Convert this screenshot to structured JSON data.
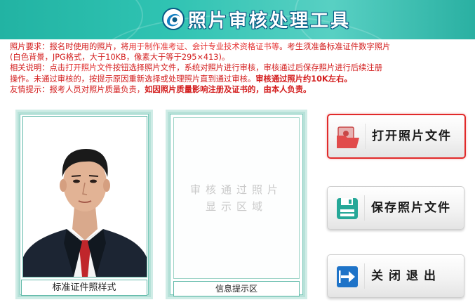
{
  "header": {
    "title": "照片审核处理工具"
  },
  "notes": {
    "line1_a": "照片要求：报名时使用的照片，将",
    "line1_b": "用于制作准考证、会计专业技术资格证书等",
    "line1_c": "。考生须准备标准证件数字照片",
    "line2": "(白色背景，JPG格式，大于10KB，像素大于等于295×413)。",
    "line3_a": "相关说明：点击",
    "line3_b": "打开照片文件",
    "line3_c": "按钮选择照片文件，系统对照片进行审核，审核通过后保存照片进行后续注册",
    "line4_a": "操作。未通过审核的，按提示原因重新选择或处理照片直到通过审核。",
    "line4_b": "审核通过照片约10K左右。",
    "line5_a": "友情提示：",
    "line5_b": "报考人员对照片质量负责，",
    "line5_c": "如因照片质量影响注册及证书的，由本人负责。"
  },
  "sample_panel": {
    "caption": "标准证件照样式"
  },
  "result_panel": {
    "placeholder_line1": "审核通过照片",
    "placeholder_line2": "显示区域",
    "caption": "信息提示区"
  },
  "buttons": {
    "open": {
      "label": "打开照片文件",
      "icon": "open-photo-folder-icon"
    },
    "save": {
      "label": "保存照片文件",
      "icon": "save-floppy-icon"
    },
    "close": {
      "label": "关闭退出",
      "icon": "exit-arrow-icon"
    }
  },
  "colors": {
    "header": "#2fc3b2",
    "notes_text": "#d31c1c",
    "panel_border": "#b6e1d8",
    "active_button_border": "#e12a2a"
  }
}
